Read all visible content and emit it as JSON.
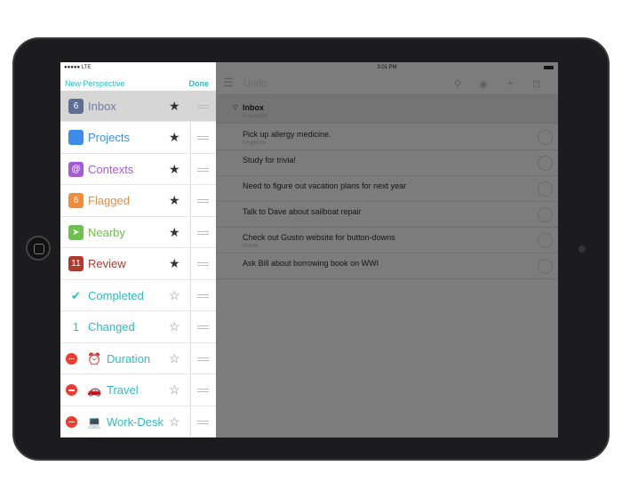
{
  "sidebar": {
    "status_left": "●●●●● LTE",
    "new_perspective": "New Perspective",
    "done": "Done",
    "items": [
      {
        "label": "Inbox",
        "badge": "6",
        "icon": "inbox-icon",
        "color": "#5d6f95",
        "label_color": "#6b7fa6",
        "starred": true,
        "deletable": false
      },
      {
        "label": "Projects",
        "badge": "",
        "icon": "projects-icon",
        "color": "#3b8ee8",
        "label_color": "#3b8ee8",
        "starred": true,
        "deletable": false
      },
      {
        "label": "Contexts",
        "badge": "@",
        "icon": "contexts-icon",
        "color": "#a55bd8",
        "label_color": "#a55bd8",
        "starred": true,
        "deletable": false
      },
      {
        "label": "Flagged",
        "badge": "6",
        "icon": "flag-icon",
        "color": "#f28c3c",
        "label_color": "#f28c3c",
        "starred": true,
        "deletable": false
      },
      {
        "label": "Nearby",
        "badge": "➤",
        "icon": "location-icon",
        "color": "#6cc24a",
        "label_color": "#6cc24a",
        "starred": true,
        "deletable": false
      },
      {
        "label": "Review",
        "badge": "11",
        "icon": "review-icon",
        "color": "#b03a2e",
        "label_color": "#b03a2e",
        "starred": true,
        "deletable": false
      },
      {
        "label": "Completed",
        "badge": "✔",
        "icon": "check-circle-icon",
        "color": "#2bbdc6",
        "label_color": "#2bbdc6",
        "starred": false,
        "deletable": false
      },
      {
        "label": "Changed",
        "badge": "1",
        "icon": "calendar-icon",
        "color": "#2bbdc6",
        "label_color": "#2bbdc6",
        "starred": false,
        "deletable": false
      },
      {
        "label": "Duration",
        "badge": "⏰",
        "icon": "alarm-icon",
        "color": "#2bbdc6",
        "label_color": "#2bbdc6",
        "starred": false,
        "deletable": true
      },
      {
        "label": "Travel",
        "badge": "🚗",
        "icon": "car-icon",
        "color": "#2bbdc6",
        "label_color": "#2bbdc6",
        "starred": false,
        "deletable": true
      },
      {
        "label": "Work-Desk",
        "badge": "💻",
        "icon": "laptop-icon",
        "color": "#2bbdc6",
        "label_color": "#2bbdc6",
        "starred": false,
        "deletable": true
      }
    ]
  },
  "main": {
    "time": "3:01 PM",
    "undo": "Undo",
    "section_title": "Inbox",
    "section_sub": "6 available",
    "tasks": [
      {
        "title": "Pick up allergy medicine.",
        "context": "Drugstore"
      },
      {
        "title": "Study for trivia!",
        "context": ""
      },
      {
        "title": "Need to figure out vacation plans for next year",
        "context": ""
      },
      {
        "title": "Talk to Dave about sailboat repair",
        "context": ""
      },
      {
        "title": "Check out Gustin website for button-downs",
        "context": "Online"
      },
      {
        "title": "Ask Bill about borrowing book on WWI",
        "context": ""
      }
    ]
  }
}
